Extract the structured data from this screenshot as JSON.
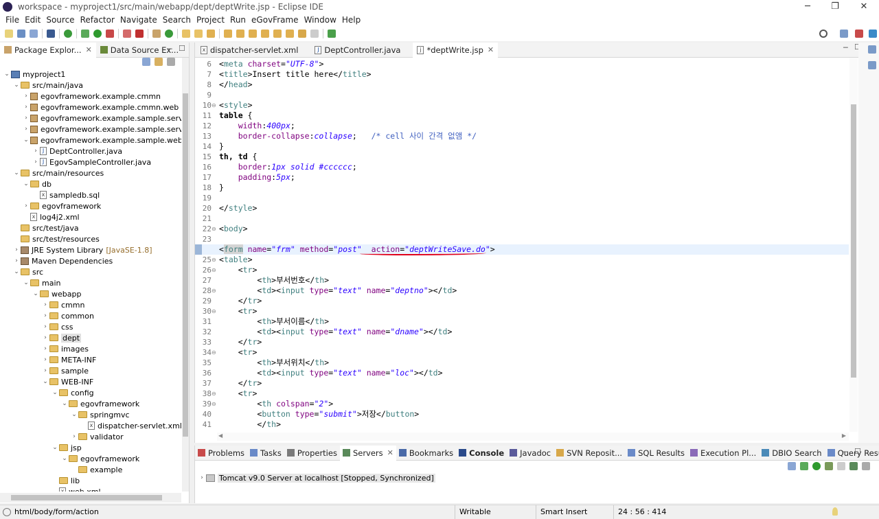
{
  "window": {
    "title": "workspace - myproject1/src/main/webapp/dept/deptWrite.jsp - Eclipse IDE"
  },
  "menu": [
    "File",
    "Edit",
    "Source",
    "Refactor",
    "Navigate",
    "Search",
    "Project",
    "Run",
    "eGovFrame",
    "Window",
    "Help"
  ],
  "left_tabs": [
    {
      "label": "Package Explor..."
    },
    {
      "label": "Data Source Ex..."
    }
  ],
  "tree": [
    {
      "depth": 0,
      "exp": "v",
      "icon": "proj",
      "label": "myproject1"
    },
    {
      "depth": 1,
      "exp": "v",
      "icon": "folder",
      "label": "src/main/java"
    },
    {
      "depth": 2,
      "exp": ">",
      "icon": "pkg",
      "label": "egovframework.example.cmmn"
    },
    {
      "depth": 2,
      "exp": ">",
      "icon": "pkg",
      "label": "egovframework.example.cmmn.web"
    },
    {
      "depth": 2,
      "exp": ">",
      "icon": "pkg",
      "label": "egovframework.example.sample.service"
    },
    {
      "depth": 2,
      "exp": ">",
      "icon": "pkg",
      "label": "egovframework.example.sample.service.im"
    },
    {
      "depth": 2,
      "exp": "v",
      "icon": "pkg",
      "label": "egovframework.example.sample.web"
    },
    {
      "depth": 3,
      "exp": ">",
      "icon": "java",
      "label": "DeptController.java"
    },
    {
      "depth": 3,
      "exp": ">",
      "icon": "java",
      "label": "EgovSampleController.java"
    },
    {
      "depth": 1,
      "exp": "v",
      "icon": "folder",
      "label": "src/main/resources"
    },
    {
      "depth": 2,
      "exp": "v",
      "icon": "folder",
      "label": "db"
    },
    {
      "depth": 3,
      "exp": "",
      "icon": "xml",
      "label": "sampledb.sql"
    },
    {
      "depth": 2,
      "exp": ">",
      "icon": "folder",
      "label": "egovframework"
    },
    {
      "depth": 2,
      "exp": "",
      "icon": "xml",
      "label": "log4j2.xml"
    },
    {
      "depth": 1,
      "exp": "",
      "icon": "folder",
      "label": "src/test/java"
    },
    {
      "depth": 1,
      "exp": "",
      "icon": "folder",
      "label": "src/test/resources"
    },
    {
      "depth": 1,
      "exp": ">",
      "icon": "lib",
      "label": "JRE System Library",
      "suffix": "[JavaSE-1.8]"
    },
    {
      "depth": 1,
      "exp": ">",
      "icon": "lib",
      "label": "Maven Dependencies"
    },
    {
      "depth": 1,
      "exp": "v",
      "icon": "folder",
      "label": "src"
    },
    {
      "depth": 2,
      "exp": "v",
      "icon": "folder",
      "label": "main"
    },
    {
      "depth": 3,
      "exp": "v",
      "icon": "folder",
      "label": "webapp"
    },
    {
      "depth": 4,
      "exp": ">",
      "icon": "folder",
      "label": "cmmn"
    },
    {
      "depth": 4,
      "exp": ">",
      "icon": "folder",
      "label": "common"
    },
    {
      "depth": 4,
      "exp": ">",
      "icon": "folder",
      "label": "css"
    },
    {
      "depth": 4,
      "exp": ">",
      "icon": "folder",
      "label": "dept",
      "selected": true
    },
    {
      "depth": 4,
      "exp": ">",
      "icon": "folder",
      "label": "images"
    },
    {
      "depth": 4,
      "exp": ">",
      "icon": "folder",
      "label": "META-INF"
    },
    {
      "depth": 4,
      "exp": ">",
      "icon": "folder",
      "label": "sample"
    },
    {
      "depth": 4,
      "exp": "v",
      "icon": "folder",
      "label": "WEB-INF"
    },
    {
      "depth": 5,
      "exp": "v",
      "icon": "folder",
      "label": "config"
    },
    {
      "depth": 6,
      "exp": "v",
      "icon": "folder",
      "label": "egovframework"
    },
    {
      "depth": 7,
      "exp": "v",
      "icon": "folder",
      "label": "springmvc"
    },
    {
      "depth": 8,
      "exp": "",
      "icon": "xml",
      "label": "dispatcher-servlet.xml"
    },
    {
      "depth": 7,
      "exp": ">",
      "icon": "folder",
      "label": "validator"
    },
    {
      "depth": 5,
      "exp": "v",
      "icon": "folder",
      "label": "jsp"
    },
    {
      "depth": 6,
      "exp": "v",
      "icon": "folder",
      "label": "egovframework"
    },
    {
      "depth": 7,
      "exp": "",
      "icon": "folder",
      "label": "example"
    },
    {
      "depth": 5,
      "exp": "",
      "icon": "folder",
      "label": "lib"
    },
    {
      "depth": 5,
      "exp": "",
      "icon": "xml",
      "label": "web.xml"
    }
  ],
  "editor_tabs": [
    {
      "label": "dispatcher-servlet.xml",
      "icon": "xml"
    },
    {
      "label": "DeptController.java",
      "icon": "java"
    },
    {
      "label": "*deptWrite.jsp",
      "icon": "jsp",
      "active": true
    }
  ],
  "code": [
    {
      "n": "6",
      "fold": "",
      "seg": [
        [
          "tx",
          "<"
        ],
        [
          "tg",
          "meta "
        ],
        [
          "at",
          "charset"
        ],
        [
          "tx",
          "="
        ],
        [
          "av",
          "\"UTF-8\""
        ],
        [
          "tx",
          ">"
        ]
      ]
    },
    {
      "n": "7",
      "fold": "",
      "seg": [
        [
          "tx",
          "<"
        ],
        [
          "tg",
          "title"
        ],
        [
          "tx",
          ">Insert title here</"
        ],
        [
          "tg",
          "title"
        ],
        [
          "tx",
          ">"
        ]
      ]
    },
    {
      "n": "8",
      "fold": "",
      "seg": [
        [
          "tx",
          "</"
        ],
        [
          "tg",
          "head"
        ],
        [
          "tx",
          ">"
        ]
      ]
    },
    {
      "n": "9",
      "fold": "",
      "seg": []
    },
    {
      "n": "10",
      "fold": "⊖",
      "seg": [
        [
          "tx",
          "<"
        ],
        [
          "tg",
          "style"
        ],
        [
          "tx",
          ">"
        ]
      ]
    },
    {
      "n": "11",
      "fold": "",
      "seg": [
        [
          "sel",
          "table "
        ],
        [
          "tx",
          "{"
        ]
      ]
    },
    {
      "n": "12",
      "fold": "",
      "seg": [
        [
          "tx",
          "    "
        ],
        [
          "pr",
          "width"
        ],
        [
          "tx",
          ":"
        ],
        [
          "vl",
          "400px"
        ],
        [
          "tx",
          ";"
        ]
      ]
    },
    {
      "n": "13",
      "fold": "",
      "seg": [
        [
          "tx",
          "    "
        ],
        [
          "pr",
          "border-collapse"
        ],
        [
          "tx",
          ":"
        ],
        [
          "vl",
          "collapse"
        ],
        [
          "tx",
          ";   "
        ],
        [
          "cm",
          "/* cell 사이 간격 없앰 */"
        ]
      ]
    },
    {
      "n": "14",
      "fold": "",
      "seg": [
        [
          "tx",
          "}"
        ]
      ]
    },
    {
      "n": "15",
      "fold": "",
      "seg": [
        [
          "sel",
          "th, td "
        ],
        [
          "tx",
          "{"
        ]
      ]
    },
    {
      "n": "16",
      "fold": "",
      "seg": [
        [
          "tx",
          "    "
        ],
        [
          "pr",
          "border"
        ],
        [
          "tx",
          ":"
        ],
        [
          "vl",
          "1px solid #cccccc"
        ],
        [
          "tx",
          ";"
        ]
      ]
    },
    {
      "n": "17",
      "fold": "",
      "seg": [
        [
          "tx",
          "    "
        ],
        [
          "pr",
          "padding"
        ],
        [
          "tx",
          ":"
        ],
        [
          "vl",
          "5px"
        ],
        [
          "tx",
          ";"
        ]
      ]
    },
    {
      "n": "18",
      "fold": "",
      "seg": [
        [
          "tx",
          "}"
        ]
      ]
    },
    {
      "n": "19",
      "fold": "",
      "seg": []
    },
    {
      "n": "20",
      "fold": "",
      "seg": [
        [
          "tx",
          "</"
        ],
        [
          "tg",
          "style"
        ],
        [
          "tx",
          ">"
        ]
      ]
    },
    {
      "n": "21",
      "fold": "",
      "seg": []
    },
    {
      "n": "22",
      "fold": "⊖",
      "seg": [
        [
          "tx",
          "<"
        ],
        [
          "tg",
          "body"
        ],
        [
          "tx",
          ">"
        ]
      ]
    },
    {
      "n": "23",
      "fold": "",
      "seg": []
    },
    {
      "n": "24",
      "fold": "⊖",
      "current": true,
      "seg": [
        [
          "tx",
          "<"
        ],
        [
          "tg",
          "form"
        ],
        [
          "tx",
          " "
        ],
        [
          "at",
          "name"
        ],
        [
          "tx",
          "="
        ],
        [
          "av",
          "\"frm\""
        ],
        [
          "tx",
          " "
        ],
        [
          "at",
          "method"
        ],
        [
          "tx",
          "="
        ],
        [
          "av",
          "\"post\""
        ],
        [
          "tx",
          "  "
        ],
        [
          "at",
          "action"
        ],
        [
          "tx",
          "="
        ],
        [
          "av",
          "\"deptWriteSave.do\""
        ],
        [
          "tx",
          ">"
        ]
      ]
    },
    {
      "n": "25",
      "fold": "⊖",
      "seg": [
        [
          "tx",
          "<"
        ],
        [
          "tg",
          "table"
        ],
        [
          "tx",
          ">"
        ]
      ]
    },
    {
      "n": "26",
      "fold": "⊖",
      "seg": [
        [
          "tx",
          "    <"
        ],
        [
          "tg",
          "tr"
        ],
        [
          "tx",
          ">"
        ]
      ]
    },
    {
      "n": "27",
      "fold": "",
      "seg": [
        [
          "tx",
          "        <"
        ],
        [
          "tg",
          "th"
        ],
        [
          "tx",
          ">부서번호</"
        ],
        [
          "tg",
          "th"
        ],
        [
          "tx",
          ">"
        ]
      ]
    },
    {
      "n": "28",
      "fold": "⊖",
      "seg": [
        [
          "tx",
          "        <"
        ],
        [
          "tg",
          "td"
        ],
        [
          "tx",
          "><"
        ],
        [
          "tg",
          "input "
        ],
        [
          "at",
          "type"
        ],
        [
          "tx",
          "="
        ],
        [
          "av",
          "\"text\""
        ],
        [
          "tx",
          " "
        ],
        [
          "at",
          "name"
        ],
        [
          "tx",
          "="
        ],
        [
          "av",
          "\"deptno\""
        ],
        [
          "tx",
          "></"
        ],
        [
          "tg",
          "td"
        ],
        [
          "tx",
          ">"
        ]
      ]
    },
    {
      "n": "29",
      "fold": "",
      "seg": [
        [
          "tx",
          "    </"
        ],
        [
          "tg",
          "tr"
        ],
        [
          "tx",
          ">"
        ]
      ]
    },
    {
      "n": "30",
      "fold": "⊖",
      "seg": [
        [
          "tx",
          "    <"
        ],
        [
          "tg",
          "tr"
        ],
        [
          "tx",
          ">"
        ]
      ]
    },
    {
      "n": "31",
      "fold": "",
      "seg": [
        [
          "tx",
          "        <"
        ],
        [
          "tg",
          "th"
        ],
        [
          "tx",
          ">부서이름</"
        ],
        [
          "tg",
          "th"
        ],
        [
          "tx",
          ">"
        ]
      ]
    },
    {
      "n": "32",
      "fold": "",
      "seg": [
        [
          "tx",
          "        <"
        ],
        [
          "tg",
          "td"
        ],
        [
          "tx",
          "><"
        ],
        [
          "tg",
          "input "
        ],
        [
          "at",
          "type"
        ],
        [
          "tx",
          "="
        ],
        [
          "av",
          "\"text\""
        ],
        [
          "tx",
          " "
        ],
        [
          "at",
          "name"
        ],
        [
          "tx",
          "="
        ],
        [
          "av",
          "\"dname\""
        ],
        [
          "tx",
          "></"
        ],
        [
          "tg",
          "td"
        ],
        [
          "tx",
          ">"
        ]
      ]
    },
    {
      "n": "33",
      "fold": "",
      "seg": [
        [
          "tx",
          "    </"
        ],
        [
          "tg",
          "tr"
        ],
        [
          "tx",
          ">"
        ]
      ]
    },
    {
      "n": "34",
      "fold": "⊖",
      "seg": [
        [
          "tx",
          "    <"
        ],
        [
          "tg",
          "tr"
        ],
        [
          "tx",
          ">"
        ]
      ]
    },
    {
      "n": "35",
      "fold": "",
      "seg": [
        [
          "tx",
          "        <"
        ],
        [
          "tg",
          "th"
        ],
        [
          "tx",
          ">부서위치</"
        ],
        [
          "tg",
          "th"
        ],
        [
          "tx",
          ">"
        ]
      ]
    },
    {
      "n": "36",
      "fold": "",
      "seg": [
        [
          "tx",
          "        <"
        ],
        [
          "tg",
          "td"
        ],
        [
          "tx",
          "><"
        ],
        [
          "tg",
          "input "
        ],
        [
          "at",
          "type"
        ],
        [
          "tx",
          "="
        ],
        [
          "av",
          "\"text\""
        ],
        [
          "tx",
          " "
        ],
        [
          "at",
          "name"
        ],
        [
          "tx",
          "="
        ],
        [
          "av",
          "\"loc\""
        ],
        [
          "tx",
          "></"
        ],
        [
          "tg",
          "td"
        ],
        [
          "tx",
          ">"
        ]
      ]
    },
    {
      "n": "37",
      "fold": "",
      "seg": [
        [
          "tx",
          "    </"
        ],
        [
          "tg",
          "tr"
        ],
        [
          "tx",
          ">"
        ]
      ]
    },
    {
      "n": "38",
      "fold": "⊖",
      "seg": [
        [
          "tx",
          "    <"
        ],
        [
          "tg",
          "tr"
        ],
        [
          "tx",
          ">"
        ]
      ]
    },
    {
      "n": "39",
      "fold": "⊖",
      "seg": [
        [
          "tx",
          "        <"
        ],
        [
          "tg",
          "th "
        ],
        [
          "at",
          "colspan"
        ],
        [
          "tx",
          "="
        ],
        [
          "av",
          "\"2\""
        ],
        [
          "tx",
          ">"
        ]
      ]
    },
    {
      "n": "40",
      "fold": "",
      "seg": [
        [
          "tx",
          "        <"
        ],
        [
          "tg",
          "button "
        ],
        [
          "at",
          "type"
        ],
        [
          "tx",
          "="
        ],
        [
          "av",
          "\"submit\""
        ],
        [
          "tx",
          ">저장</"
        ],
        [
          "tg",
          "button"
        ],
        [
          "tx",
          ">"
        ]
      ]
    },
    {
      "n": "41",
      "fold": "",
      "seg": [
        [
          "tx",
          "        </"
        ],
        [
          "tg",
          "th"
        ],
        [
          "tx",
          ">"
        ]
      ]
    }
  ],
  "bottom_tabs": [
    {
      "label": "Problems"
    },
    {
      "label": "Tasks"
    },
    {
      "label": "Properties"
    },
    {
      "label": "Servers",
      "active": true
    },
    {
      "label": "Bookmarks"
    },
    {
      "label": "Console",
      "bold": true
    },
    {
      "label": "Javadoc"
    },
    {
      "label": "SVN Reposit..."
    },
    {
      "label": "SQL Results"
    },
    {
      "label": "Execution Pl..."
    },
    {
      "label": "DBIO Search"
    },
    {
      "label": "Query Result"
    }
  ],
  "server": {
    "label": "Tomcat v9.0 Server at localhost  [Stopped, Synchronized]"
  },
  "status": {
    "path": "html/body/form/action",
    "mode": "Writable",
    "insert": "Smart Insert",
    "pos": "24 : 56 : 414"
  },
  "colors": {
    "accent": "#e0001b",
    "selection": "#dce8f8",
    "current_line": "#e8f2fe"
  }
}
